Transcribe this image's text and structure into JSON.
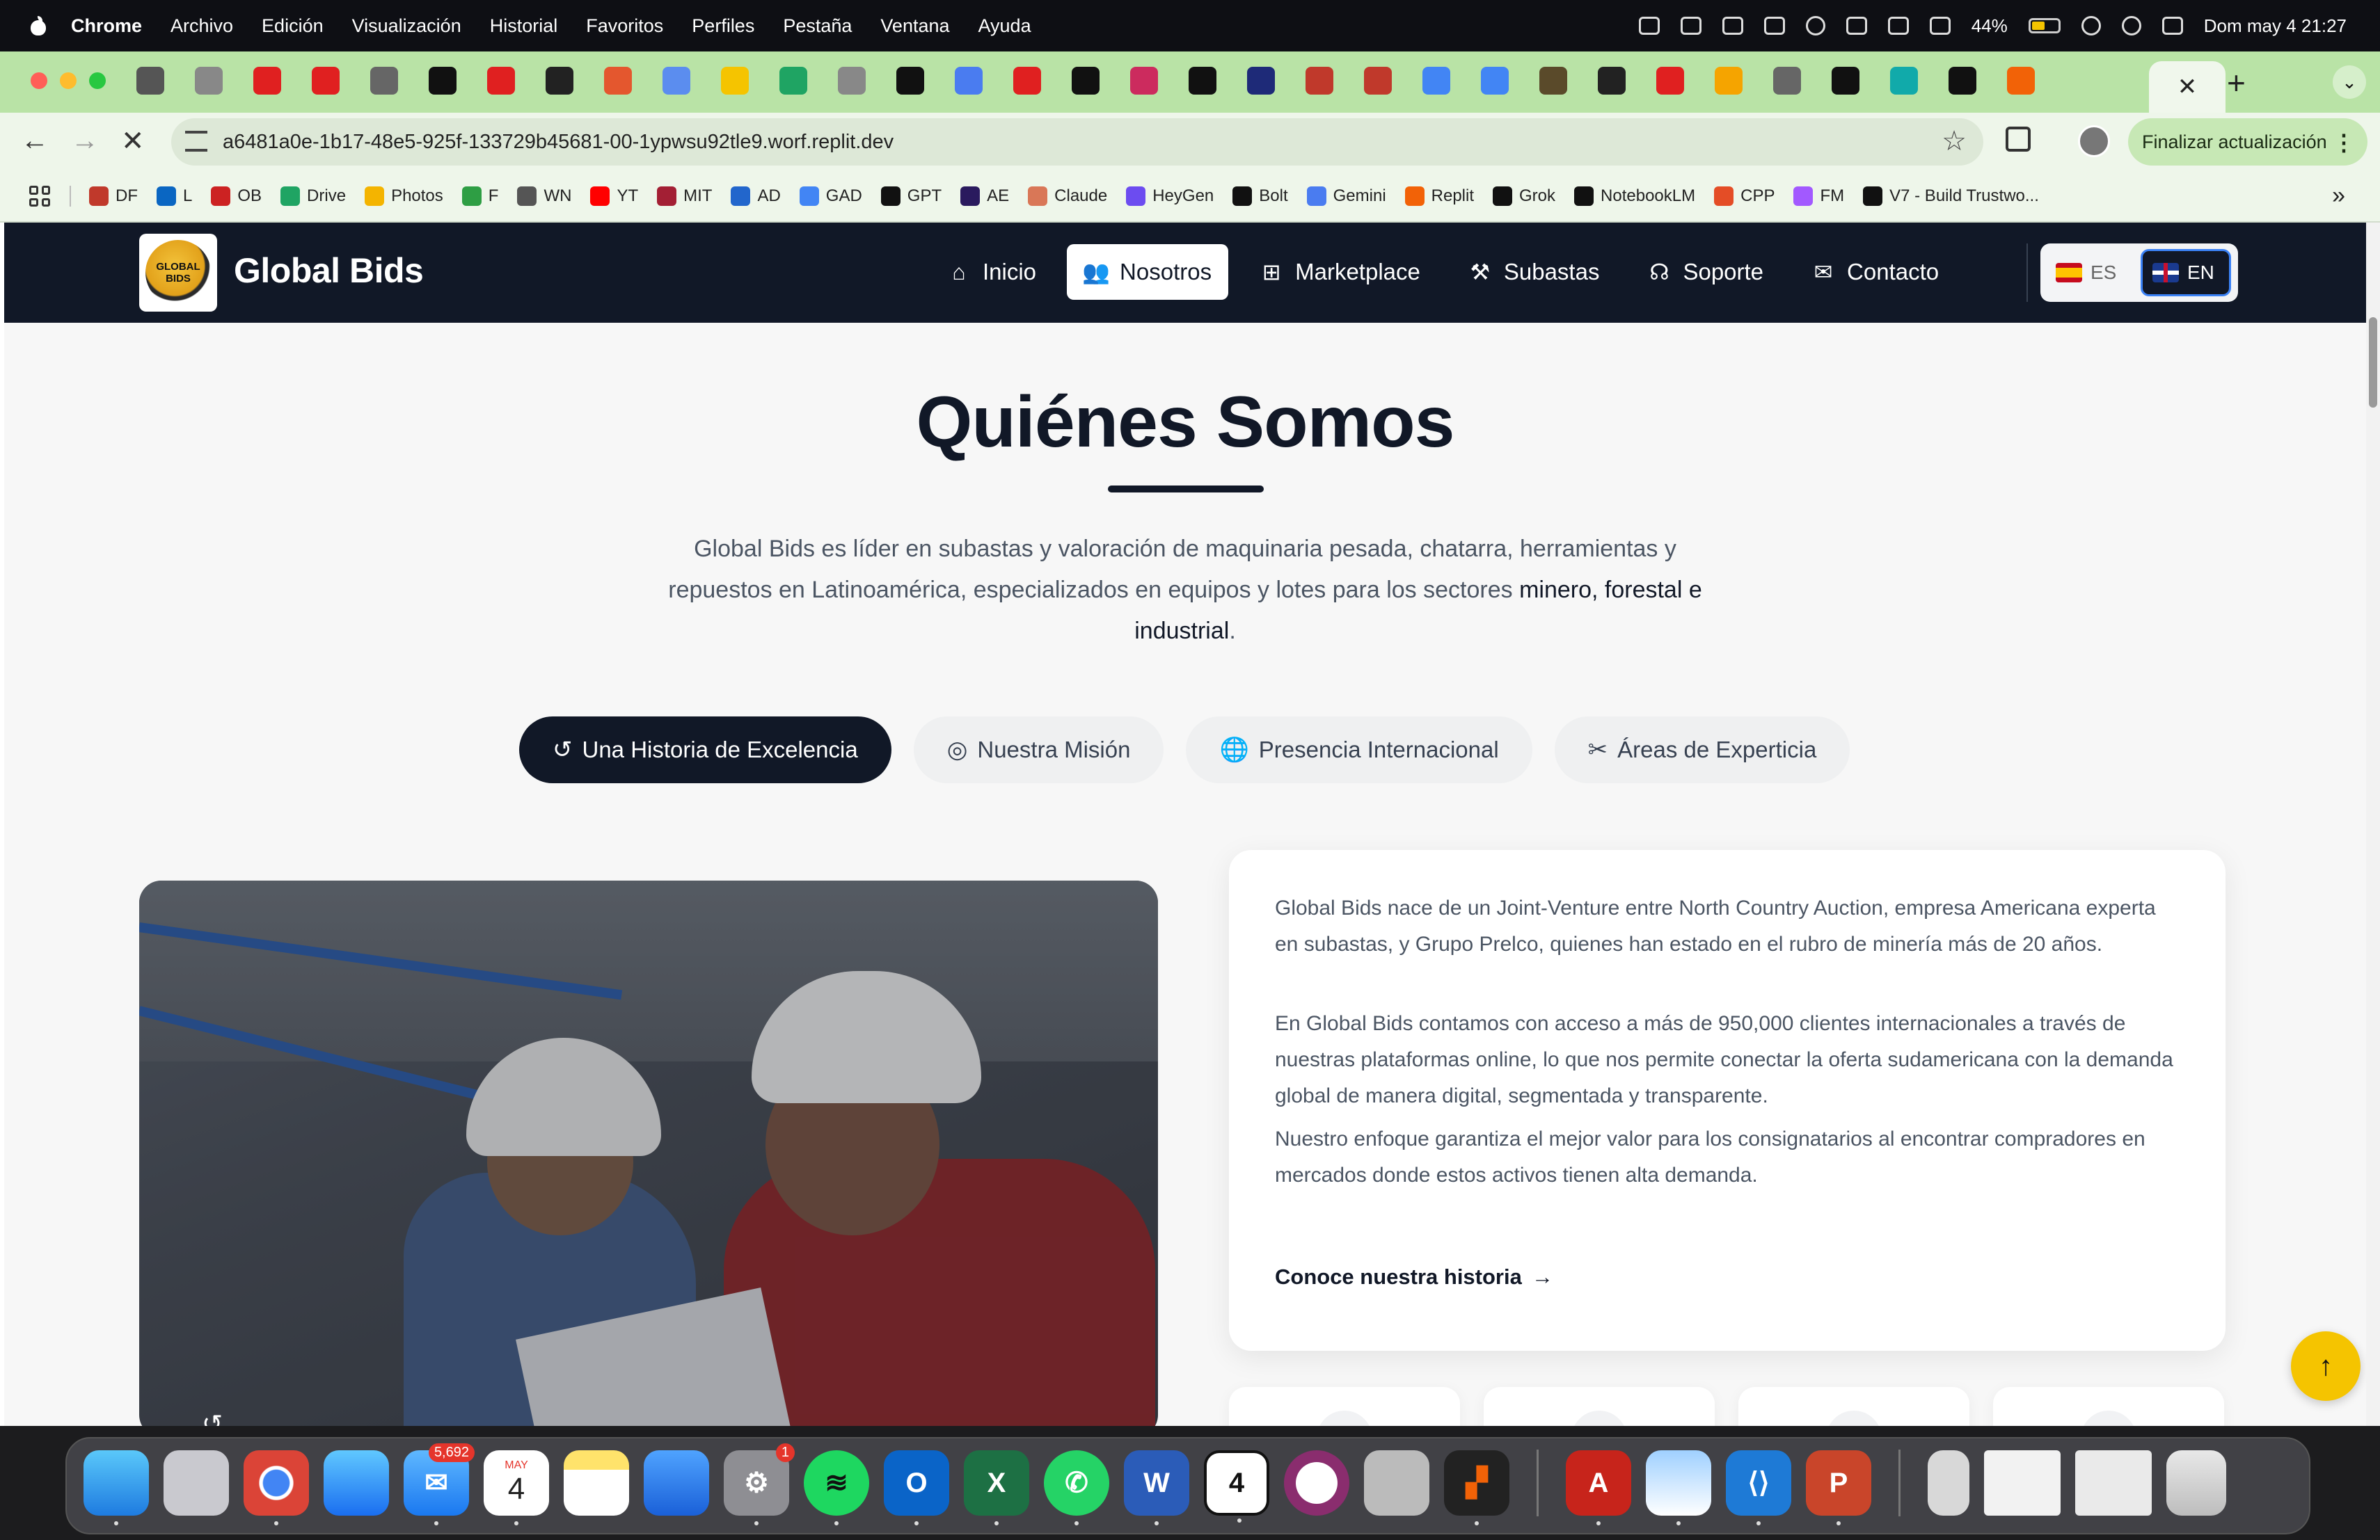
{
  "menubar": {
    "app": "Chrome",
    "items": [
      "Archivo",
      "Edición",
      "Visualización",
      "Historial",
      "Favoritos",
      "Perfiles",
      "Pestaña",
      "Ventana",
      "Ayuda"
    ],
    "battery": "44%",
    "datetime": "Dom may 4  21:27"
  },
  "browser": {
    "url": "a6481a0e-1b17-48e5-925f-133729b45681-00-1ypwsu92tle9.worf.replit.dev",
    "update_button": "Finalizar actualización",
    "new_tab": "+",
    "bookmarks": [
      "DF",
      "L",
      "OB",
      "Drive",
      "Photos",
      "F",
      "WN",
      "YT",
      "MIT",
      "AD",
      "GAD",
      "GPT",
      "AE",
      "Claude",
      "HeyGen",
      "Bolt",
      "Gemini",
      "Replit",
      "Grok",
      "NotebookLM",
      "CPP",
      "FM",
      "V7 - Build Trustwo..."
    ],
    "bookmark_colors": [
      "#c0392b",
      "#0a66c2",
      "#cc2222",
      "#1fa463",
      "#f4b400",
      "#2e9e44",
      "#555555",
      "#ff0000",
      "#a31f34",
      "#2266cc",
      "#4285f4",
      "#111111",
      "#2a1a5e",
      "#d97757",
      "#6c4cf0",
      "#111111",
      "#4a7cf0",
      "#f26207",
      "#111111",
      "#111111",
      "#e44d26",
      "#a259ff",
      "#111111"
    ]
  },
  "site": {
    "brand": "Global Bids",
    "nav": [
      {
        "label": "Inicio",
        "icon": "home-icon"
      },
      {
        "label": "Nosotros",
        "icon": "users-icon"
      },
      {
        "label": "Marketplace",
        "icon": "grid-icon"
      },
      {
        "label": "Subastas",
        "icon": "gavel-icon"
      },
      {
        "label": "Soporte",
        "icon": "headset-icon"
      },
      {
        "label": "Contacto",
        "icon": "envelope-icon"
      }
    ],
    "lang": {
      "es": "ES",
      "en": "EN",
      "active": "EN"
    },
    "title": "Quiénes Somos",
    "intro": {
      "text": "Global Bids es líder en subastas y valoración de maquinaria pesada, chatarra, herramientas y repuestos en Latinoamérica, especializados en equipos y lotes para los sectores ",
      "strong": "minero, forestal e industrial",
      "end": "."
    },
    "tabs": [
      {
        "label": "Una Historia de Excelencia",
        "icon": "history-icon"
      },
      {
        "label": "Nuestra Misión",
        "icon": "target-icon"
      },
      {
        "label": "Presencia Internacional",
        "icon": "globe-icon"
      },
      {
        "label": "Áreas de Experticia",
        "icon": "tools-icon"
      }
    ],
    "card": {
      "p1": "Global Bids nace de un Joint-Venture entre North Country Auction, empresa Americana experta en subastas, y Grupo Prelco, quienes han estado en el rubro de minería más de 20 años.",
      "p2": "En Global Bids contamos con acceso a más de 950,000 clientes internacionales a través de nuestras plataformas online, lo que nos permite conectar la oferta sudamericana con la demanda global de manera digital, segmentada y transparente.",
      "p3": "Nuestro enfoque garantiza el mejor valor para los consignatarios al encontrar compradores en mercados donde estos activos tienen alta demanda.",
      "link": "Conoce nuestra historia"
    },
    "colors": {
      "navy": "#111827",
      "accent": "#f5c400"
    }
  },
  "dock": {
    "mail_badge": "5,692",
    "calendar_month": "MAY",
    "calendar_day": "4",
    "settings_badge": "1"
  }
}
